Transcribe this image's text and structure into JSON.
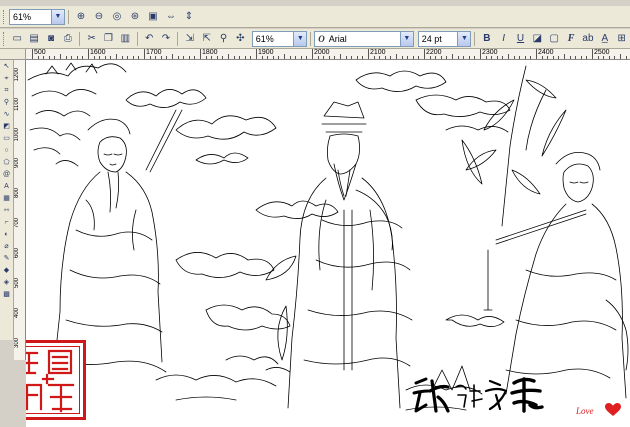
{
  "toolbar1": {
    "zoom_value": "61%",
    "icons": [
      "zoom-in-icon",
      "zoom-out-icon",
      "zoom-selection-icon",
      "zoom-all-icon",
      "zoom-page-icon",
      "zoom-width-icon",
      "zoom-height-icon"
    ]
  },
  "toolbar2": {
    "icons_left": [
      "new-icon",
      "open-icon",
      "save-icon",
      "print-icon",
      "cut-icon",
      "copy-icon",
      "paste-icon",
      "undo-icon",
      "redo-icon",
      "import-icon",
      "export-icon",
      "app-launcher-icon"
    ],
    "zoom_value": "61%",
    "font_value": "Arial",
    "font_size_value": "24 pt",
    "icons_right": [
      "bold-icon",
      "italic-icon",
      "underline-icon",
      "fill-icon",
      "outline-icon",
      "format-text-icon",
      "edit-text-icon",
      "char-icon"
    ]
  },
  "hruler": {
    "labels": [
      "500",
      "1600",
      "1700",
      "1800",
      "1900",
      "2000",
      "2100",
      "2200",
      "2300",
      "2400",
      "2500"
    ]
  },
  "vruler": {
    "labels": [
      "1200",
      "1100",
      "1000",
      "900",
      "800",
      "700",
      "600",
      "500",
      "400",
      "300"
    ]
  },
  "toolbox": {
    "icons": [
      "pick-tool-icon",
      "shape-tool-icon",
      "crop-tool-icon",
      "zoom-tool-icon",
      "freehand-tool-icon",
      "smart-fill-icon",
      "rectangle-tool-icon",
      "ellipse-tool-icon",
      "polygon-tool-icon",
      "text-tool-icon",
      "table-tool-icon",
      "dimension-tool-icon",
      "connector-tool-icon",
      "blend-tool-icon",
      "eyedropper-tool-icon",
      "outline-tool-icon",
      "fill-tool-icon",
      "interactive-fill-icon"
    ]
  },
  "canvas": {
    "seal_color": "#d01818",
    "love_text": "Love",
    "heart_color": "#e02020"
  }
}
